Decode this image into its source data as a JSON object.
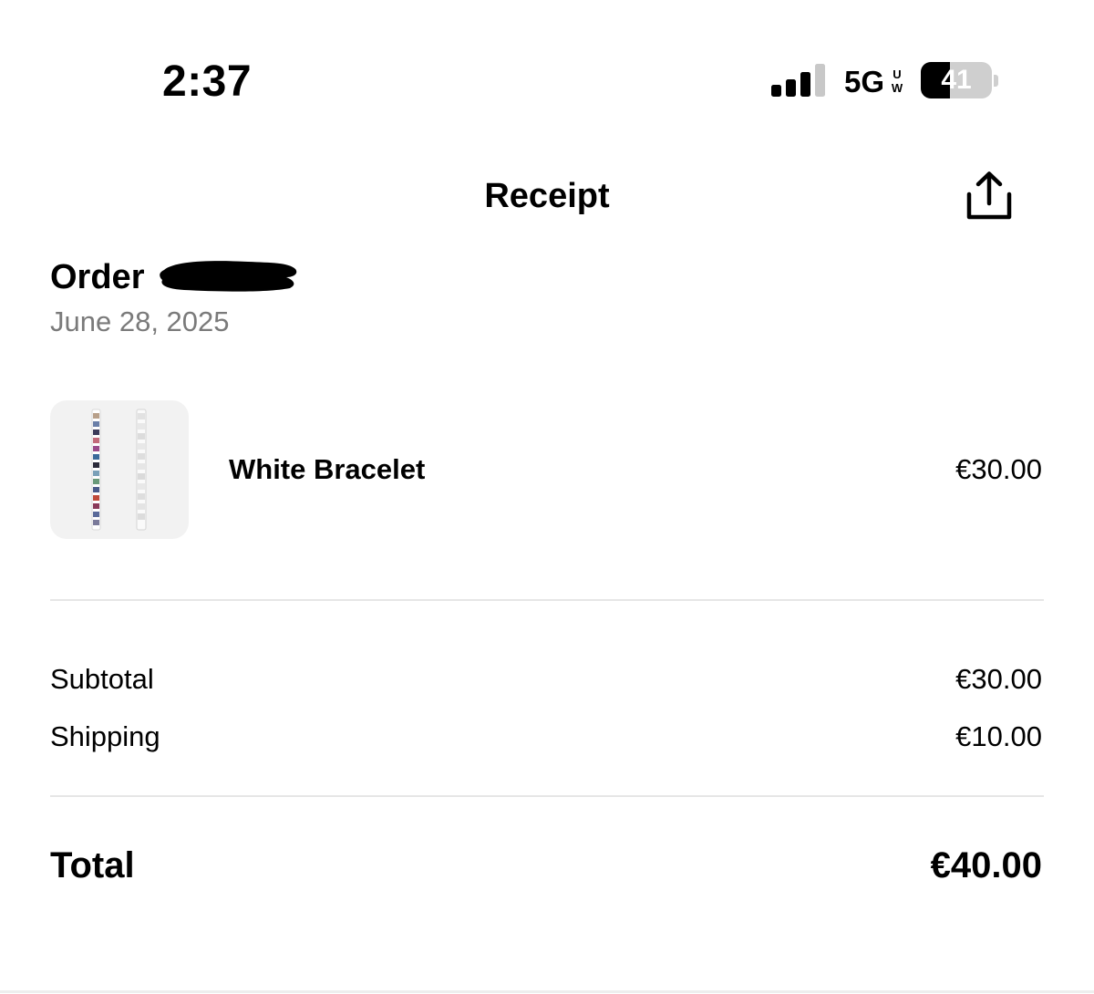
{
  "status_bar": {
    "time": "2:37",
    "network": "5G",
    "network_badge": "UW",
    "battery_percent": "41",
    "battery_level": 0.41,
    "signal_bars_active": 3,
    "signal_bars_total": 4,
    "icons": [
      "signal-icon",
      "battery-icon"
    ]
  },
  "nav": {
    "title": "Receipt",
    "share_icon": "share-icon"
  },
  "order": {
    "label": "Order",
    "date": "June 28, 2025"
  },
  "items": [
    {
      "name": "White Bracelet",
      "price": "€30.00",
      "thumbnail": "bracelet-image"
    }
  ],
  "summary": {
    "subtotal_label": "Subtotal",
    "subtotal_value": "€30.00",
    "shipping_label": "Shipping",
    "shipping_value": "€10.00",
    "total_label": "Total",
    "total_value": "€40.00"
  },
  "colors": {
    "background": "#ffffff",
    "text": "#000000",
    "secondary_text": "#7a7a7a",
    "divider": "#e6e6e6",
    "thumb_background": "#f2f2f2"
  }
}
